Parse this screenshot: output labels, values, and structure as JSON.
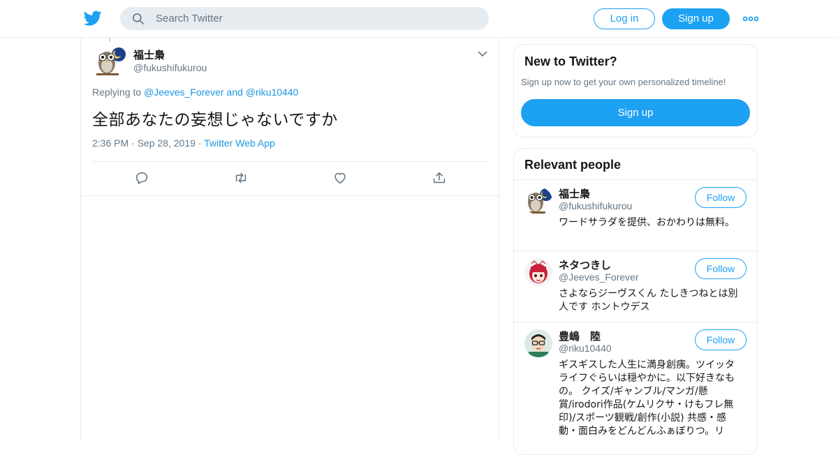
{
  "header": {
    "search_placeholder": "Search Twitter",
    "login_label": "Log in",
    "signup_label": "Sign up"
  },
  "tweet": {
    "author_name": "福士梟",
    "author_handle": "@fukushifukurou",
    "replying_prefix": "Replying to ",
    "reply_to_1": "@Jeeves_Forever",
    "reply_and": " and ",
    "reply_to_2": "@riku10440",
    "text": "全部あなたの妄想じゃないですか",
    "time": "2:36 PM",
    "sep": " · ",
    "date": "Sep 28, 2019",
    "source": "Twitter Web App"
  },
  "sidebar": {
    "new_title": "New to Twitter?",
    "new_subtitle": "Sign up now to get your own personalized timeline!",
    "new_signup_label": "Sign up",
    "people_title": "Relevant people",
    "people": [
      {
        "name": "福士梟",
        "handle": "@fukushifukurou",
        "bio": "ワードサラダを提供、おかわりは無料。",
        "follow_label": "Follow"
      },
      {
        "name": "ネタつきし",
        "handle": "@Jeeves_Forever",
        "bio": "さよならジーヴスくん たしきつねとは別人です ホントウデス",
        "follow_label": "Follow"
      },
      {
        "name": "豊嶋　陸",
        "handle": "@riku10440",
        "bio": "ギスギスした人生に満身創痍。ツイッタライフぐらいは穏やかに。以下好きなもの。 クイズ/ギャンブル/マンガ/懸賞/irodori作品(ケムリクサ・けもフレ無印)/スポーツ観戦/創作(小説) 共感・感動・面白みをどんどんふぁぼりつ。リ",
        "follow_label": "Follow"
      }
    ]
  },
  "colors": {
    "brand": "#1da1f2",
    "link": "#1b95e0",
    "muted": "#657786",
    "border": "#e6ecf0"
  },
  "icons": {
    "logo": "twitter-bird-icon",
    "search": "search-icon",
    "more": "more-dots-icon",
    "caret": "chevron-down-icon",
    "reply": "reply-icon",
    "retweet": "retweet-icon",
    "like": "heart-icon",
    "share": "share-icon"
  }
}
